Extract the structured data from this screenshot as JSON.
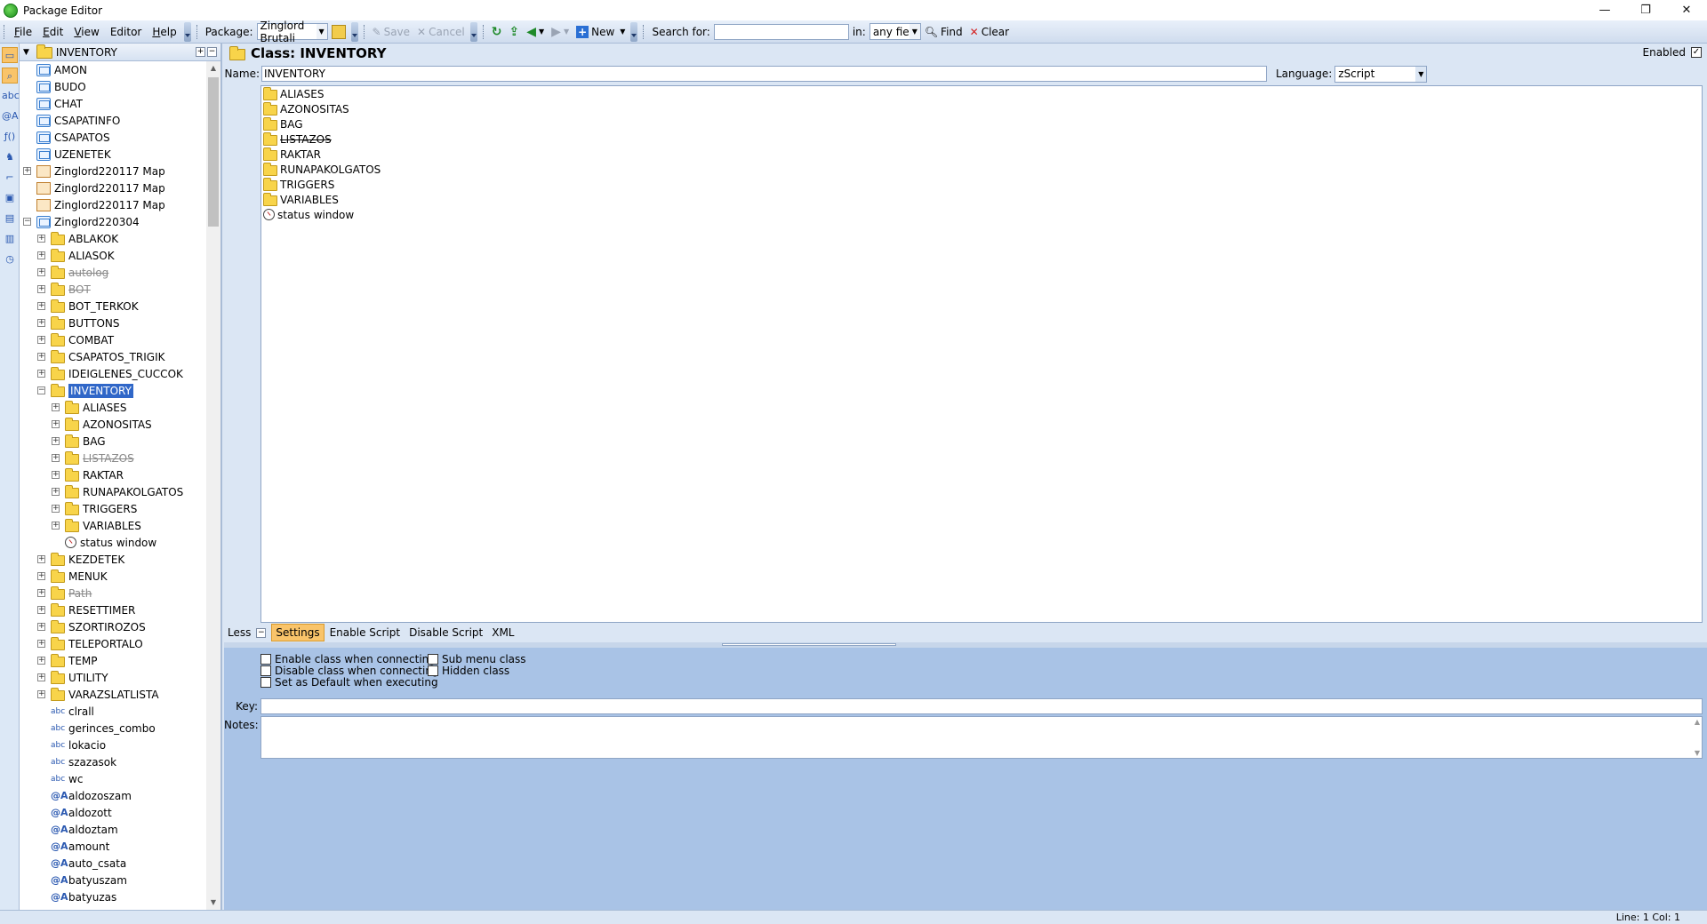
{
  "window": {
    "title": "Package Editor",
    "min": "—",
    "restore": "❐",
    "close": "✕"
  },
  "menu": [
    {
      "key": "F",
      "rest": "ile"
    },
    {
      "key": "E",
      "rest": "dit"
    },
    {
      "key": "V",
      "rest": "iew"
    },
    {
      "key": "",
      "rest": "Editor"
    },
    {
      "key": "H",
      "rest": "elp"
    }
  ],
  "toolbar": {
    "package_label": "Package:",
    "package_value": "Zinglord Brutali",
    "save": "Save",
    "cancel": "Cancel",
    "new": "New",
    "search_label": "Search for:",
    "search_value": "",
    "in_label": "in:",
    "in_value": "any field",
    "find": "Find",
    "clear": "Clear"
  },
  "tree": {
    "header": "INVENTORY",
    "items": [
      {
        "label": "AMON",
        "level": 0,
        "icon": "package",
        "exp": "none"
      },
      {
        "label": "BUDO",
        "level": 0,
        "icon": "package",
        "exp": "none"
      },
      {
        "label": "CHAT",
        "level": 0,
        "icon": "package",
        "exp": "none"
      },
      {
        "label": "CSAPATINFO",
        "level": 0,
        "icon": "package",
        "exp": "none"
      },
      {
        "label": "CSAPATOS",
        "level": 0,
        "icon": "package",
        "exp": "none"
      },
      {
        "label": "UZENETEK",
        "level": 0,
        "icon": "package",
        "exp": "none"
      },
      {
        "label": "Zinglord220117 Map",
        "level": 0,
        "icon": "map",
        "exp": "+"
      },
      {
        "label": "Zinglord220117 Map",
        "level": 0,
        "icon": "map",
        "exp": "none"
      },
      {
        "label": "Zinglord220117 Map",
        "level": 0,
        "icon": "map",
        "exp": "none"
      },
      {
        "label": "Zinglord220304",
        "level": 0,
        "icon": "package",
        "exp": "-"
      },
      {
        "label": "ABLAKOK",
        "level": 1,
        "icon": "folder",
        "exp": "+"
      },
      {
        "label": "ALIASOK",
        "level": 1,
        "icon": "folder",
        "exp": "+"
      },
      {
        "label": "autolog",
        "level": 1,
        "icon": "folder",
        "exp": "+",
        "disabled": true
      },
      {
        "label": "BOT",
        "level": 1,
        "icon": "folder",
        "exp": "+",
        "disabled": true
      },
      {
        "label": "BOT_TERKOK",
        "level": 1,
        "icon": "folder",
        "exp": "+"
      },
      {
        "label": "BUTTONS",
        "level": 1,
        "icon": "folder",
        "exp": "+"
      },
      {
        "label": "COMBAT",
        "level": 1,
        "icon": "folder",
        "exp": "+"
      },
      {
        "label": "CSAPATOS_TRIGIK",
        "level": 1,
        "icon": "folder",
        "exp": "+"
      },
      {
        "label": "IDEIGLENES_CUCCOK",
        "level": 1,
        "icon": "folder",
        "exp": "+"
      },
      {
        "label": "INVENTORY",
        "level": 1,
        "icon": "folder",
        "exp": "-",
        "selected": true
      },
      {
        "label": "ALIASES",
        "level": 2,
        "icon": "folder",
        "exp": "+"
      },
      {
        "label": "AZONOSITAS",
        "level": 2,
        "icon": "folder",
        "exp": "+"
      },
      {
        "label": "BAG",
        "level": 2,
        "icon": "folder",
        "exp": "+"
      },
      {
        "label": "LISTAZOS",
        "level": 2,
        "icon": "folder",
        "exp": "+",
        "disabled": true
      },
      {
        "label": "RAKTAR",
        "level": 2,
        "icon": "folder",
        "exp": "+"
      },
      {
        "label": "RUNAPAKOLGATOS",
        "level": 2,
        "icon": "folder",
        "exp": "+"
      },
      {
        "label": "TRIGGERS",
        "level": 2,
        "icon": "folder",
        "exp": "+"
      },
      {
        "label": "VARIABLES",
        "level": 2,
        "icon": "folder",
        "exp": "+"
      },
      {
        "label": "status window",
        "level": 2,
        "icon": "timer",
        "exp": "none"
      },
      {
        "label": "KEZDETEK",
        "level": 1,
        "icon": "folder",
        "exp": "+"
      },
      {
        "label": "MENUK",
        "level": 1,
        "icon": "folder",
        "exp": "+"
      },
      {
        "label": "Path",
        "level": 1,
        "icon": "folder",
        "exp": "+",
        "disabled": true
      },
      {
        "label": "RESETTIMER",
        "level": 1,
        "icon": "folder",
        "exp": "+"
      },
      {
        "label": "SZORTIROZOS",
        "level": 1,
        "icon": "folder",
        "exp": "+"
      },
      {
        "label": "TELEPORTALO",
        "level": 1,
        "icon": "folder",
        "exp": "+"
      },
      {
        "label": "TEMP",
        "level": 1,
        "icon": "folder",
        "exp": "+"
      },
      {
        "label": "UTILITY",
        "level": 1,
        "icon": "folder",
        "exp": "+"
      },
      {
        "label": "VARAZSLATLISTA",
        "level": 1,
        "icon": "folder",
        "exp": "+"
      },
      {
        "label": "clrall",
        "level": 1,
        "icon": "abc",
        "exp": "none"
      },
      {
        "label": "gerinces_combo",
        "level": 1,
        "icon": "abc",
        "exp": "none"
      },
      {
        "label": "lokacio",
        "level": 1,
        "icon": "abc",
        "exp": "none"
      },
      {
        "label": "szazasok",
        "level": 1,
        "icon": "abc",
        "exp": "none"
      },
      {
        "label": "wc",
        "level": 1,
        "icon": "abc",
        "exp": "none"
      },
      {
        "label": "aldozoszam",
        "level": 1,
        "icon": "var",
        "exp": "none"
      },
      {
        "label": "aldozott",
        "level": 1,
        "icon": "var",
        "exp": "none"
      },
      {
        "label": "aldoztam",
        "level": 1,
        "icon": "var",
        "exp": "none"
      },
      {
        "label": "amount",
        "level": 1,
        "icon": "var",
        "exp": "none"
      },
      {
        "label": "auto_csata",
        "level": 1,
        "icon": "var",
        "exp": "none"
      },
      {
        "label": "batyuszam",
        "level": 1,
        "icon": "var",
        "exp": "none"
      },
      {
        "label": "batyuzas",
        "level": 1,
        "icon": "var",
        "exp": "none"
      }
    ]
  },
  "main": {
    "class_title": "Class: INVENTORY",
    "enabled_label": "Enabled",
    "name_label": "Name:",
    "name_value": "INVENTORY",
    "language_label": "Language:",
    "language_value": "zScript",
    "children": [
      {
        "label": "ALIASES",
        "icon": "folder"
      },
      {
        "label": "AZONOSITAS",
        "icon": "folder"
      },
      {
        "label": "BAG",
        "icon": "folder"
      },
      {
        "label": "LISTAZOS",
        "icon": "folder",
        "disabled": true
      },
      {
        "label": "RAKTAR",
        "icon": "folder"
      },
      {
        "label": "RUNAPAKOLGATOS",
        "icon": "folder"
      },
      {
        "label": "TRIGGERS",
        "icon": "folder"
      },
      {
        "label": "VARIABLES",
        "icon": "folder"
      },
      {
        "label": "status window",
        "icon": "timer"
      }
    ],
    "less_label": "Less",
    "tabs": [
      "Settings",
      "Enable Script",
      "Disable Script",
      "XML"
    ],
    "options": {
      "enable_connect": "Enable class when connecting",
      "disable_connect": "Disable class when connecting",
      "set_default": "Set as Default when executing",
      "sub_menu": "Sub menu class",
      "hidden": "Hidden class"
    },
    "key_label": "Key:",
    "notes_label": "Notes:"
  },
  "status": {
    "position": "Line: 1 Col: 1"
  }
}
